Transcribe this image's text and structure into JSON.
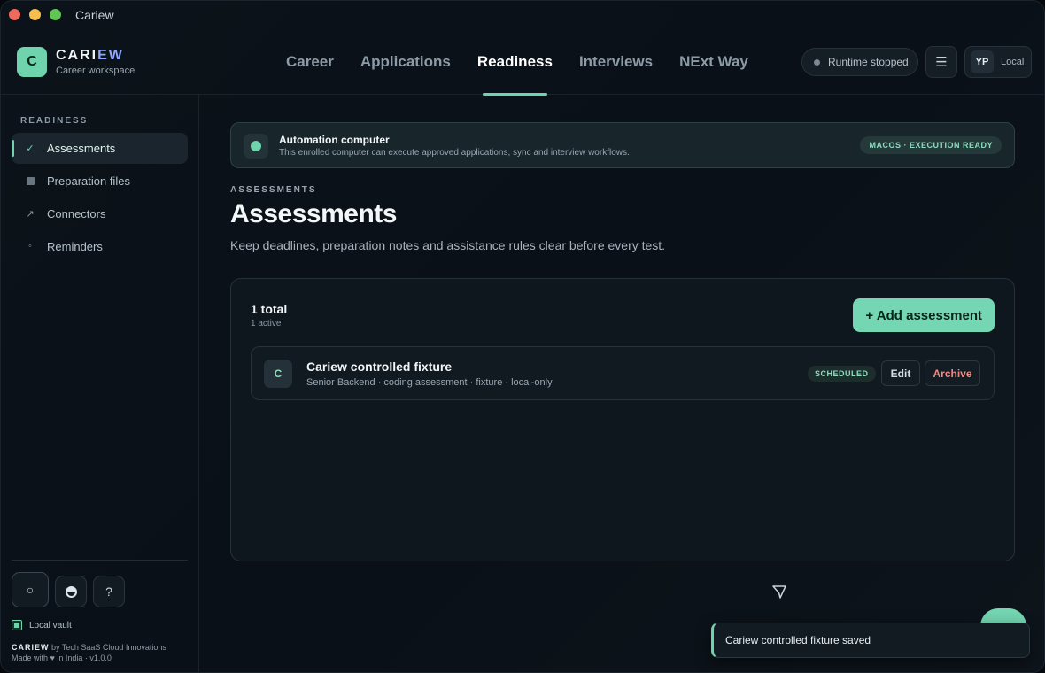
{
  "window": {
    "title": "Cariew"
  },
  "brand": {
    "logo_letter": "C",
    "name_start": "CARI",
    "name_accent": "EW",
    "subtitle": "Career workspace"
  },
  "nav": {
    "tabs": [
      {
        "label": "Career",
        "active": false
      },
      {
        "label": "Applications",
        "active": false
      },
      {
        "label": "Readiness",
        "active": true
      },
      {
        "label": "Interviews",
        "active": false
      },
      {
        "label": "NExt Way",
        "active": false
      }
    ]
  },
  "header": {
    "runtime_status": "Runtime stopped",
    "menu_icon": "hamburger-icon",
    "user_initials": "YP",
    "user_mode": "Local"
  },
  "sidebar": {
    "section_title": "READINESS",
    "items": [
      {
        "label": "Assessments",
        "icon": "check-icon",
        "active": true
      },
      {
        "label": "Preparation files",
        "icon": "square-icon",
        "active": false
      },
      {
        "label": "Connectors",
        "icon": "arrow-up-right-icon",
        "active": false
      },
      {
        "label": "Reminders",
        "icon": "dot-circle-icon",
        "active": false
      }
    ],
    "vault_label": "Local vault",
    "credit_brand": "CARIEW",
    "credit_by": "by Tech SaaS Cloud Innovations",
    "credit_made": "Made with ♥ in India · v1.0.0"
  },
  "banner": {
    "title": "Automation computer",
    "description": "This enrolled computer can execute approved applications, sync and interview workflows.",
    "badge": "MACOS · EXECUTION READY"
  },
  "page": {
    "eyebrow": "ASSESSMENTS",
    "title": "Assessments",
    "description": "Keep deadlines, preparation notes and assistance rules clear before every test."
  },
  "panel": {
    "total": "1 total",
    "active": "1 active",
    "add_button": "+ Add assessment",
    "rows": [
      {
        "logo_letter": "C",
        "title": "Cariew controlled fixture",
        "subtitle": "Senior Backend · coding assessment · fixture · local-only",
        "status": "SCHEDULED",
        "edit_label": "Edit",
        "archive_label": "Archive"
      }
    ]
  },
  "toast": {
    "message": "Cariew controlled fixture saved"
  },
  "colors": {
    "accent": "#6fd3ad",
    "danger": "#f08a84",
    "background": "#0a1017"
  }
}
